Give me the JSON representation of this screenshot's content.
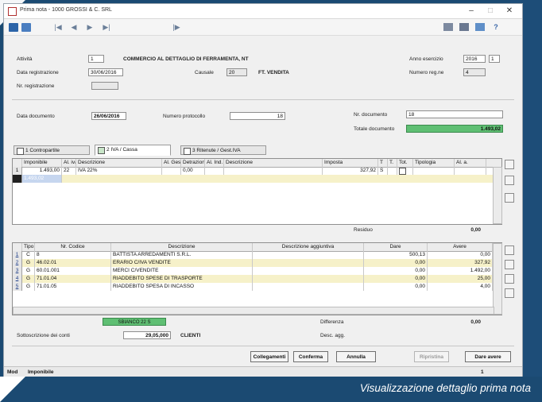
{
  "window": {
    "title": "Prima nota - 1000 GROSSI & C. SRL",
    "minimize": "–",
    "maximize": "□",
    "close": "✕"
  },
  "toolbar": {
    "nav_first": "|◀",
    "nav_prev": "◀",
    "nav_next": "▶",
    "nav_last": "▶|",
    "nav_extra": "|▶"
  },
  "header": {
    "attivita_label": "Attività",
    "attivita_value": "1",
    "attivita_desc": "COMMERCIO AL DETTAGLIO DI FERRAMENTA, NT",
    "anno_esercizio_label": "Anno esercizio",
    "anno_esercizio_value": "2016",
    "anno_esercizio_extra": "1",
    "data_reg_label": "Data registrazione",
    "data_reg_value": "30/06/2016",
    "causale_label": "Causale",
    "causale_value": "20",
    "causale_desc": "FT. VENDITA",
    "numero_reg_label": "Numero reg.ne",
    "numero_reg_value": "4",
    "nr_reg_label": "Nr. registrazione",
    "nr_reg_value": ""
  },
  "document": {
    "data_label": "Data documento",
    "data_value": "26/06/2016",
    "protocollo_label": "Numero protocollo",
    "protocollo_value": "18",
    "nr_doc_label": "Nr. documento",
    "nr_doc_value": "18",
    "totale_label": "Totale documento",
    "totale_value": "1.493,02"
  },
  "tabs": [
    {
      "label": "1 Contropartite"
    },
    {
      "label": "2 IVA / Cassa"
    },
    {
      "label": "3 Ritenute / Gest.IVA"
    }
  ],
  "iva_grid": {
    "headers": [
      "",
      "Imponibile",
      "Al. iva",
      "Descrizione",
      "Al. Ges.",
      "Detrazione",
      "Al. Ind.",
      "Descrizione",
      "Imposta",
      "T",
      "T.",
      "Tot.",
      "Tipologia",
      "Al. a."
    ],
    "rows": [
      {
        "n": "1",
        "imponibile": "1.493,00",
        "aliq": "22",
        "descr": "IVA 22%",
        "det": "0,00",
        "imposta": "327,92",
        "flag": "S"
      },
      {
        "n": "",
        "imponibile": "1.493,02",
        "aliq": "",
        "descr": "",
        "det": "",
        "imposta": "",
        "flag": ""
      }
    ]
  },
  "residuo": {
    "label": "Residuo",
    "value": "0,00"
  },
  "entries_grid": {
    "headers": [
      "Tipo",
      "Nr. Codice",
      "Descrizione",
      "Descrizione aggiuntiva",
      "Dare",
      "Avere"
    ],
    "rows": [
      {
        "n": "1",
        "tipo": "C",
        "codice": "8",
        "descr": "BATTISTA ARREDAMENTI S.R.L.",
        "aggiuntiva": "",
        "dare": "500,13",
        "avere": "0,00"
      },
      {
        "n": "2",
        "tipo": "G",
        "codice": "46.02.01",
        "descr": "ERARIO C/IVA VENDITE",
        "aggiuntiva": "",
        "dare": "0,00",
        "avere": "327,92"
      },
      {
        "n": "3",
        "tipo": "G",
        "codice": "60.01.001",
        "descr": "MERCI C/VENDITE",
        "aggiuntiva": "",
        "dare": "0,00",
        "avere": "1.492,00"
      },
      {
        "n": "4",
        "tipo": "G",
        "codice": "71.01.04",
        "descr": "RIADDEBITO SPESE DI TRASPORTE",
        "aggiuntiva": "",
        "dare": "0,00",
        "avere": "25,00"
      },
      {
        "n": "5",
        "tipo": "G",
        "codice": "71.01.05",
        "descr": "RIADDEBITO SPESA DI INCASSO",
        "aggiuntiva": "",
        "dare": "0,00",
        "avere": "4,00"
      }
    ]
  },
  "footer": {
    "saldo_label": "SBIANCO",
    "saldo_value": "22 S",
    "differenza_label": "Differenza",
    "differenza_value": "0,00",
    "sottoconto_label": "Sottoscrizione dei conti",
    "sottoconto_value": "29,05,000",
    "sottoconto_desc": "CLIENTI",
    "desc_agg_label": "Desc. agg."
  },
  "buttons": {
    "collegamenti": "Collegamenti",
    "conferma": "Conferma",
    "annulla": "Annulla",
    "ripristina": "Ripristina",
    "dare_avere": "Dare avere"
  },
  "status": {
    "mode": "Mod",
    "field": "Imponibile",
    "page": "1"
  },
  "caption": "Visualizzazione dettaglio prima nota"
}
